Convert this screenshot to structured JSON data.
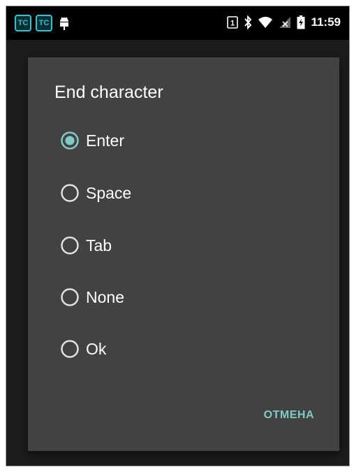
{
  "status_bar": {
    "app_icon_1": "tc-app-icon",
    "app_icon_2": "tc-app-icon",
    "app_icon_label": "TC",
    "notification_icon": "android-debug-icon",
    "sim_label": "1",
    "time": "11:59"
  },
  "dialog": {
    "title": "End character",
    "options": [
      {
        "label": "Enter",
        "selected": true
      },
      {
        "label": "Space",
        "selected": false
      },
      {
        "label": "Tab",
        "selected": false
      },
      {
        "label": "None",
        "selected": false
      },
      {
        "label": "Ok",
        "selected": false
      }
    ],
    "cancel_label": "ОТМЕНА"
  },
  "colors": {
    "accent": "#80cbc4",
    "dialog_bg": "#424242",
    "radio_unselected": "#e0e0e0"
  }
}
